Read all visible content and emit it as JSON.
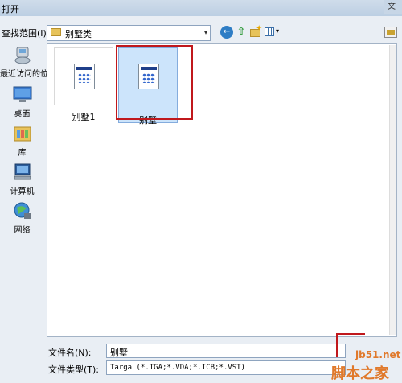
{
  "window": {
    "title": "打开",
    "close_glyph": "文"
  },
  "toolbar": {
    "lookin_label": "查找范围(I):",
    "lookin_value": "别墅类",
    "back_glyph": "←",
    "up_glyph": "⇧",
    "views_arrow": "▾"
  },
  "places": [
    {
      "label": "最近访问的位置",
      "icon": "recent-places-icon"
    },
    {
      "label": "桌面",
      "icon": "desktop-icon"
    },
    {
      "label": "库",
      "icon": "libraries-icon"
    },
    {
      "label": "计算机",
      "icon": "computer-icon"
    },
    {
      "label": "网络",
      "icon": "network-icon"
    }
  ],
  "files": [
    {
      "name": "别墅1",
      "selected": false
    },
    {
      "name": "别墅",
      "selected": true
    }
  ],
  "bottom": {
    "filename_label": "文件名(N):",
    "filename_value": "别墅",
    "filetype_label": "文件类型(T):",
    "filetype_value": "Targa (*.TGA;*.VDA;*.ICB;*.VST)"
  },
  "watermark": {
    "line1": "jb51.net",
    "line2": "脚本之家"
  },
  "colors": {
    "accent": "#c0181c",
    "selection": "#cce4fb",
    "watermark": "#e0792b"
  }
}
